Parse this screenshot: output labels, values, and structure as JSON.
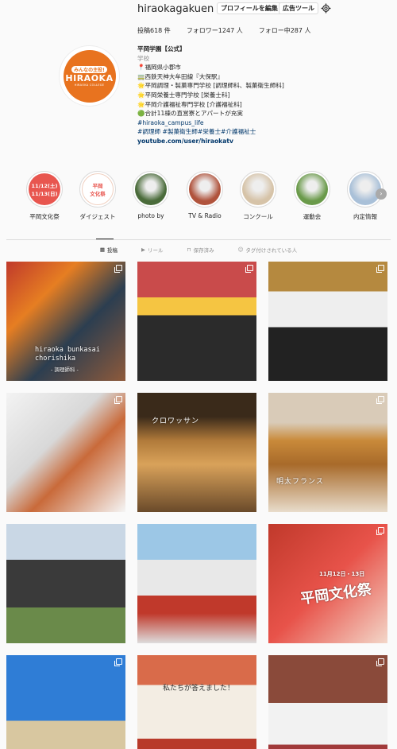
{
  "profile": {
    "username": "hiraokagakuen",
    "edit_button": "プロフィールを編集",
    "ads_button": "広告ツール",
    "stats": {
      "posts": "投稿618 件",
      "followers": "フォロワー1247 人",
      "following": "フォロー中287 人"
    },
    "avatar": {
      "slogan": "みんなの主役!",
      "name": "HIRAOKA",
      "subtitle": "HIRAOKA COLLEGE"
    },
    "bio": {
      "name": "平岡学園【公式】",
      "category": "学校",
      "lines": [
        "📍福岡県小郡市",
        "🚃西鉄天神大牟田線『大保駅』",
        "🌟平岡調理・製菓専門学校 [調理師科、製菓衛生師科]",
        "🌟平岡栄養士専門学校 [栄養士科]",
        "🌟平岡介護福祉専門学校 [介護福祉科]",
        "🟢合計11棟の直営寮とアパートが充実"
      ],
      "hashtag1": "#hiraoka_campus_life",
      "hashtag2": "#調理師 #製菓衛生師#栄養士#介護福祉士",
      "link": "youtube.com/user/hiraokatv"
    }
  },
  "highlights": [
    {
      "label": "平岡文化祭",
      "cover": "11/12(土)\n11/13(日)",
      "color": "#e8564f"
    },
    {
      "label": "ダイジェスト",
      "cover": "平岡\n文化祭",
      "color": "#e8564f"
    },
    {
      "label": "photo by",
      "cover": "",
      "color": "#4a6b3a"
    },
    {
      "label": "TV & Radio",
      "cover": "",
      "color": "#b0533c"
    },
    {
      "label": "コンクール",
      "cover": "",
      "color": "#d6c3a8"
    },
    {
      "label": "運動会",
      "cover": "",
      "color": "#6a9a4a"
    },
    {
      "label": "内定情報",
      "cover": "",
      "color": "#a9c0d8"
    }
  ],
  "tabs": [
    {
      "label": "投稿",
      "icon": "grid-icon"
    },
    {
      "label": "リール",
      "icon": "reels-icon"
    },
    {
      "label": "保存済み",
      "icon": "bookmark-icon"
    },
    {
      "label": "タグ付けされている人",
      "icon": "tagged-icon"
    }
  ],
  "posts": [
    {
      "caption": "hiraoka bunkasai\nchorishika",
      "sub": "- 調理師科 -"
    },
    {
      "caption": "",
      "sub": ""
    },
    {
      "caption": "",
      "sub": ""
    },
    {
      "caption": "",
      "sub": ""
    },
    {
      "caption": "クロワッサン",
      "sub": ""
    },
    {
      "caption": "明太フランス",
      "sub": ""
    },
    {
      "caption": "",
      "sub": ""
    },
    {
      "caption": "",
      "sub": ""
    },
    {
      "caption": "平岡文化祭",
      "sub": "11月12日・13日"
    },
    {
      "caption": "",
      "sub": ""
    },
    {
      "caption": "私たちが答えました！",
      "sub": ""
    },
    {
      "caption": "",
      "sub": ""
    }
  ]
}
